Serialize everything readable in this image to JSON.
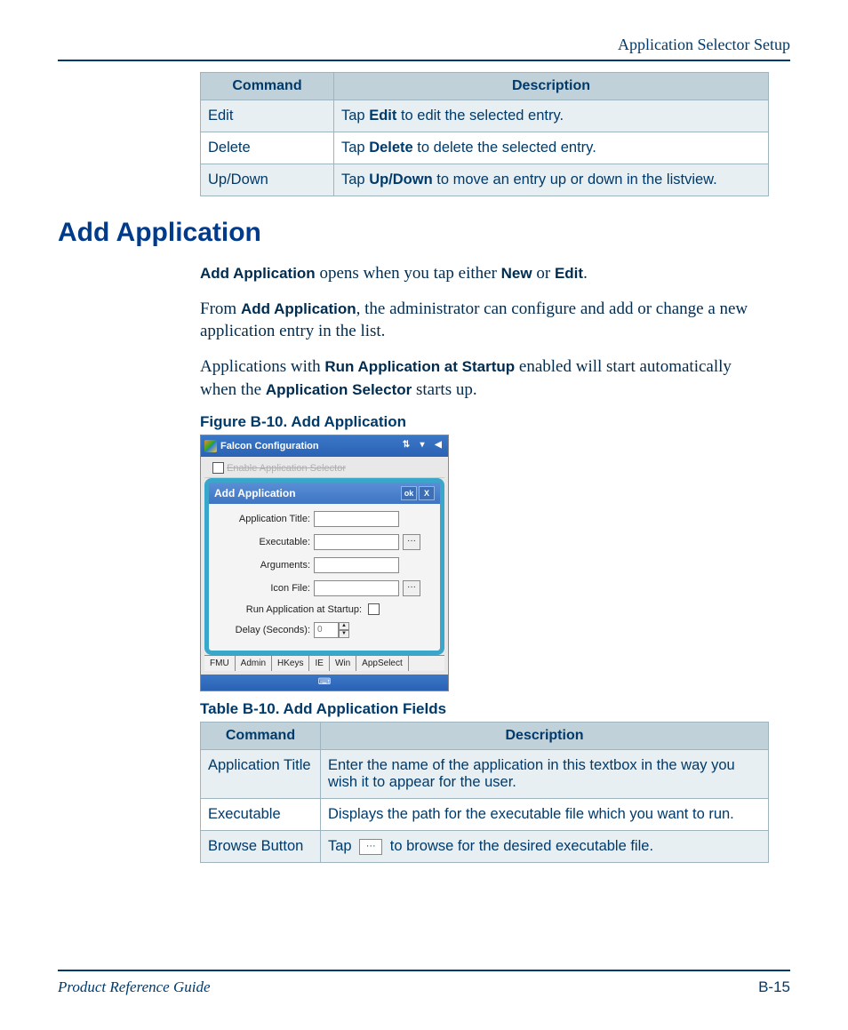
{
  "header": {
    "section": "Application Selector Setup"
  },
  "table1": {
    "headers": [
      "Command",
      "Description"
    ],
    "rows": [
      {
        "cmd": "Edit",
        "pre": "Tap ",
        "bold": "Edit",
        "post": " to edit the selected entry."
      },
      {
        "cmd": "Delete",
        "pre": "Tap ",
        "bold": "Delete",
        "post": " to delete the selected entry."
      },
      {
        "cmd": "Up/Down",
        "pre": "Tap ",
        "bold": "Up/Down",
        "post": " to move an entry up or down in the listview."
      }
    ]
  },
  "h1": "Add Application",
  "p1": {
    "b1": "Add Application",
    "t1": " opens when you tap either ",
    "b2": "New",
    "t2": " or ",
    "b3": "Edit",
    "t3": "."
  },
  "p2": {
    "t0": "From ",
    "b1": "Add Application",
    "t1": ", the administrator can configure and add or change a new application entry in the list."
  },
  "p3": {
    "t0": "Applications with ",
    "b1": "Run Application at Startup",
    "t1": " enabled will start automatically when the ",
    "b2": "Application Selector",
    "t2": " starts up."
  },
  "figcap": "Figure B-10. Add Application",
  "shot": {
    "titlebar": "Falcon Configuration",
    "ghost": "Enable Application Selector",
    "panelTitle": "Add Application",
    "ok": "ok",
    "close": "X",
    "fields": {
      "appTitle": "Application Title:",
      "exec": "Executable:",
      "args": "Arguments:",
      "icon": "Icon File:",
      "runStartup": "Run Application at Startup:",
      "delay": "Delay (Seconds):",
      "delayVal": "0"
    },
    "tabs": [
      "FMU",
      "Admin",
      "HKeys",
      "IE",
      "Win",
      "AppSelect"
    ]
  },
  "tblcap": "Table B-10. Add Application Fields",
  "table2": {
    "headers": [
      "Command",
      "Description"
    ],
    "rows": [
      {
        "cmd": "Application Title",
        "desc": "Enter the name of the application in this textbox in the way you wish it to appear for the user."
      },
      {
        "cmd": "Executable",
        "desc": "Displays the path for the executable file which you want to run."
      },
      {
        "cmd": "Browse Button",
        "pre": "Tap ",
        "post": " to browse for the desired executable file.",
        "browse": "···"
      }
    ]
  },
  "footer": {
    "left": "Product Reference Guide",
    "right": "B-15"
  }
}
